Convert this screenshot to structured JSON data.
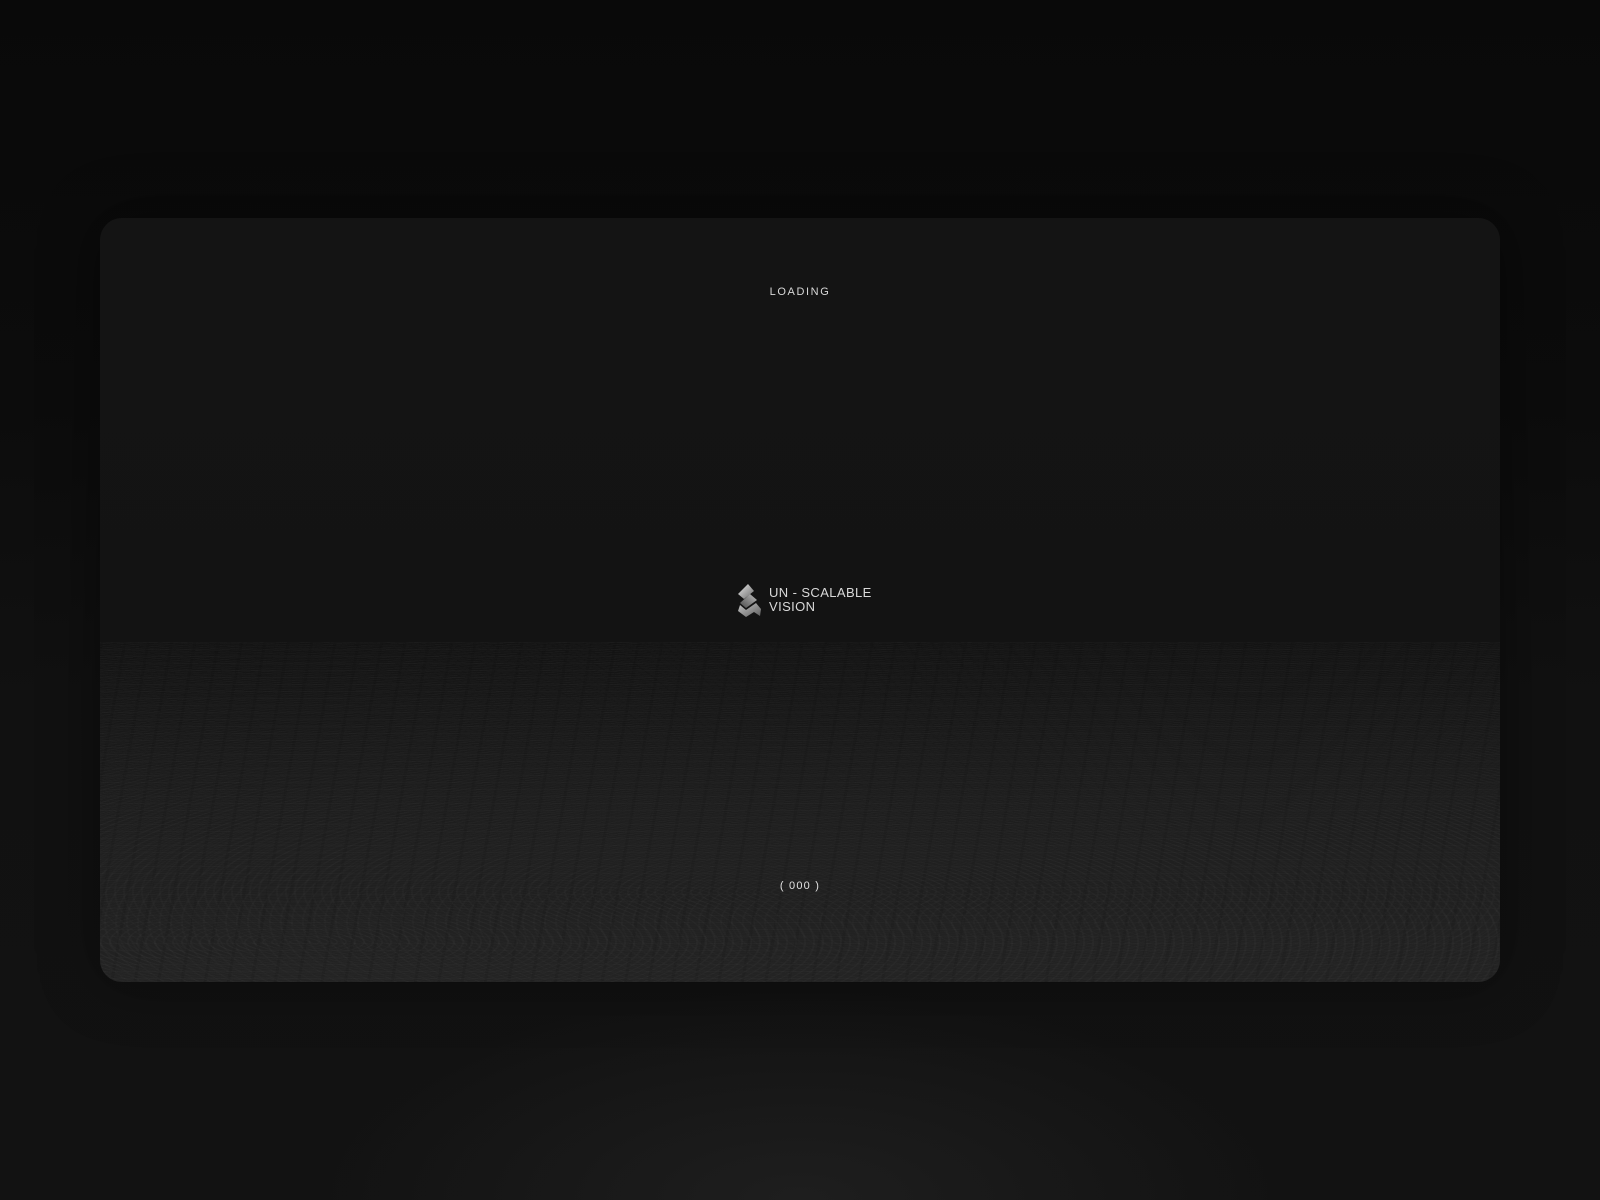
{
  "loader": {
    "status_label": "LOADING",
    "counter_text": "( 000 )",
    "progress_value": 0
  },
  "logo": {
    "line1": "UN - SCALABLE",
    "line2": "VISION",
    "icon": "stacked-chevron-logo-icon"
  },
  "colors": {
    "background": "#0b0b0b",
    "frame": "#141414",
    "text": "#d9d9d9"
  }
}
